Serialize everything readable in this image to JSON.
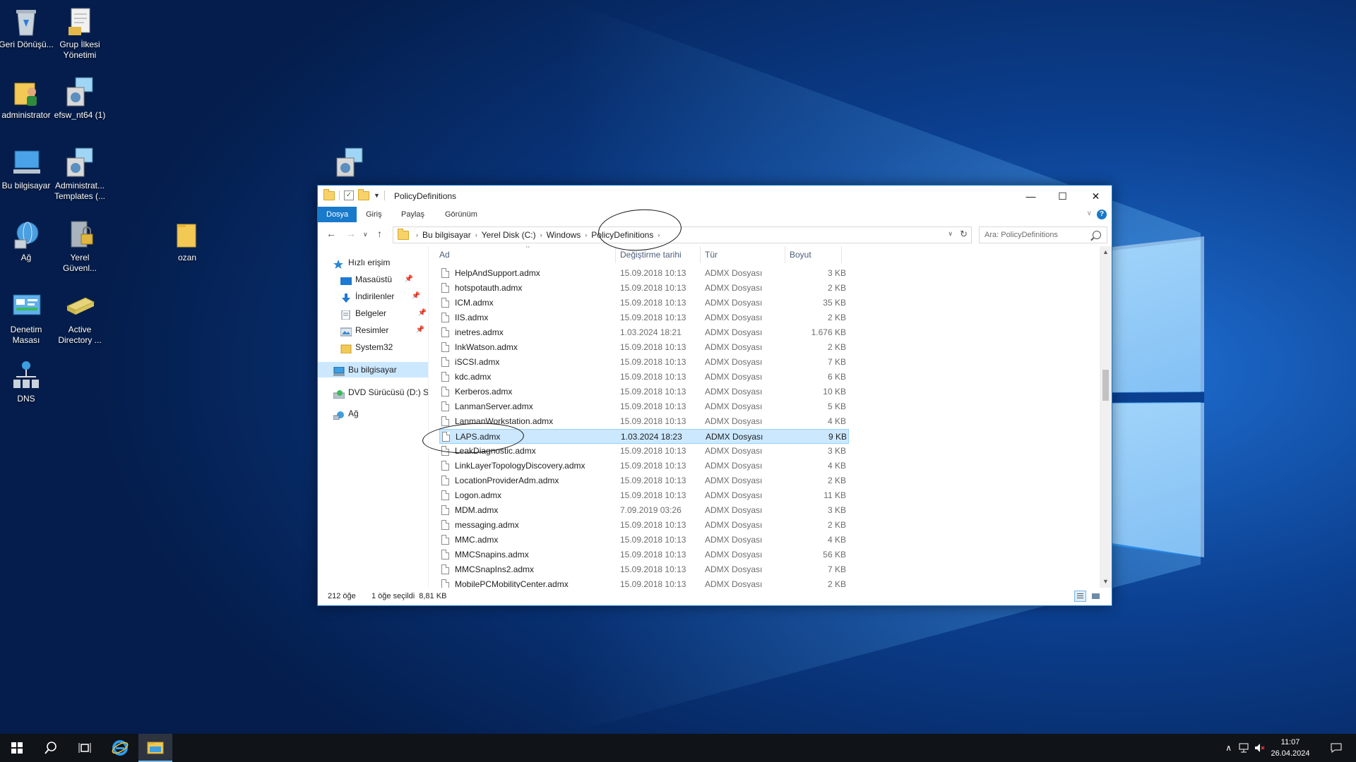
{
  "desktop": {
    "icons": [
      {
        "id": "recycle",
        "label": "Geri Dönüşü..."
      },
      {
        "id": "gpm",
        "label": "Grup İlkesi Yönetimi"
      },
      {
        "id": "admin",
        "label": "administrator"
      },
      {
        "id": "efsw",
        "label": "efsw_nt64 (1)"
      },
      {
        "id": "thispc",
        "label": "Bu bilgisayar"
      },
      {
        "id": "admtemplates",
        "label": "Administrat... Templates (..."
      },
      {
        "id": "network",
        "label": "Ağ"
      },
      {
        "id": "localsec",
        "label": "Yerel Güvenl..."
      },
      {
        "id": "ozan",
        "label": "ozan"
      },
      {
        "id": "control",
        "label": "Denetim Masası"
      },
      {
        "id": "ad",
        "label": "Active Directory ..."
      },
      {
        "id": "dns",
        "label": "DNS"
      }
    ]
  },
  "window": {
    "title": "PolicyDefinitions",
    "controls": {
      "minimize": "—",
      "maximize": "☐",
      "close": "✕"
    },
    "ribbon_tabs": [
      "Dosya",
      "Giriş",
      "Paylaş",
      "Görünüm"
    ],
    "breadcrumb": [
      "Bu bilgisayar",
      "Yerel Disk (C:)",
      "Windows",
      "PolicyDefinitions"
    ],
    "search_placeholder": "Ara: PolicyDefinitions",
    "help": "?",
    "nav": {
      "quick_access": "Hızlı erişim",
      "items": [
        {
          "label": "Masaüstü"
        },
        {
          "label": "İndirilenler"
        },
        {
          "label": "Belgeler"
        },
        {
          "label": "Resimler"
        },
        {
          "label": "System32"
        }
      ],
      "this_pc": "Bu bilgisayar",
      "dvd": "DVD Sürücüsü (D:) SS",
      "network": "Ağ"
    },
    "columns": {
      "name": "Ad",
      "date": "Değiştirme tarihi",
      "type": "Tür",
      "size": "Boyut"
    },
    "files": [
      {
        "name": "HelpAndSupport.admx",
        "date": "15.09.2018 10:13",
        "type": "ADMX Dosyası",
        "size": "3 KB"
      },
      {
        "name": "hotspotauth.admx",
        "date": "15.09.2018 10:13",
        "type": "ADMX Dosyası",
        "size": "2 KB"
      },
      {
        "name": "ICM.admx",
        "date": "15.09.2018 10:13",
        "type": "ADMX Dosyası",
        "size": "35 KB"
      },
      {
        "name": "IIS.admx",
        "date": "15.09.2018 10:13",
        "type": "ADMX Dosyası",
        "size": "2 KB"
      },
      {
        "name": "inetres.admx",
        "date": "1.03.2024 18:21",
        "type": "ADMX Dosyası",
        "size": "1.676 KB"
      },
      {
        "name": "InkWatson.admx",
        "date": "15.09.2018 10:13",
        "type": "ADMX Dosyası",
        "size": "2 KB"
      },
      {
        "name": "iSCSI.admx",
        "date": "15.09.2018 10:13",
        "type": "ADMX Dosyası",
        "size": "7 KB"
      },
      {
        "name": "kdc.admx",
        "date": "15.09.2018 10:13",
        "type": "ADMX Dosyası",
        "size": "6 KB"
      },
      {
        "name": "Kerberos.admx",
        "date": "15.09.2018 10:13",
        "type": "ADMX Dosyası",
        "size": "10 KB"
      },
      {
        "name": "LanmanServer.admx",
        "date": "15.09.2018 10:13",
        "type": "ADMX Dosyası",
        "size": "5 KB"
      },
      {
        "name": "LanmanWorkstation.admx",
        "date": "15.09.2018 10:13",
        "type": "ADMX Dosyası",
        "size": "4 KB"
      },
      {
        "name": "LAPS.admx",
        "date": "1.03.2024 18:23",
        "type": "ADMX Dosyası",
        "size": "9 KB",
        "selected": true
      },
      {
        "name": "LeakDiagnostic.admx",
        "date": "15.09.2018 10:13",
        "type": "ADMX Dosyası",
        "size": "3 KB"
      },
      {
        "name": "LinkLayerTopologyDiscovery.admx",
        "date": "15.09.2018 10:13",
        "type": "ADMX Dosyası",
        "size": "4 KB"
      },
      {
        "name": "LocationProviderAdm.admx",
        "date": "15.09.2018 10:13",
        "type": "ADMX Dosyası",
        "size": "2 KB"
      },
      {
        "name": "Logon.admx",
        "date": "15.09.2018 10:13",
        "type": "ADMX Dosyası",
        "size": "11 KB"
      },
      {
        "name": "MDM.admx",
        "date": "7.09.2019 03:26",
        "type": "ADMX Dosyası",
        "size": "3 KB"
      },
      {
        "name": "messaging.admx",
        "date": "15.09.2018 10:13",
        "type": "ADMX Dosyası",
        "size": "2 KB"
      },
      {
        "name": "MMC.admx",
        "date": "15.09.2018 10:13",
        "type": "ADMX Dosyası",
        "size": "4 KB"
      },
      {
        "name": "MMCSnapins.admx",
        "date": "15.09.2018 10:13",
        "type": "ADMX Dosyası",
        "size": "56 KB"
      },
      {
        "name": "MMCSnapIns2.admx",
        "date": "15.09.2018 10:13",
        "type": "ADMX Dosyası",
        "size": "7 KB"
      },
      {
        "name": "MobilePCMobilityCenter.admx",
        "date": "15.09.2018 10:13",
        "type": "ADMX Dosyası",
        "size": "2 KB"
      }
    ],
    "status": {
      "count": "212 öğe",
      "selected": "1 öğe seçildi  8,81 KB"
    }
  },
  "taskbar": {
    "time": "11:07",
    "date": "26.04.2024"
  },
  "colors": {
    "accent": "#1979ca",
    "selection": "#cce8ff",
    "taskbar": "#101317"
  }
}
